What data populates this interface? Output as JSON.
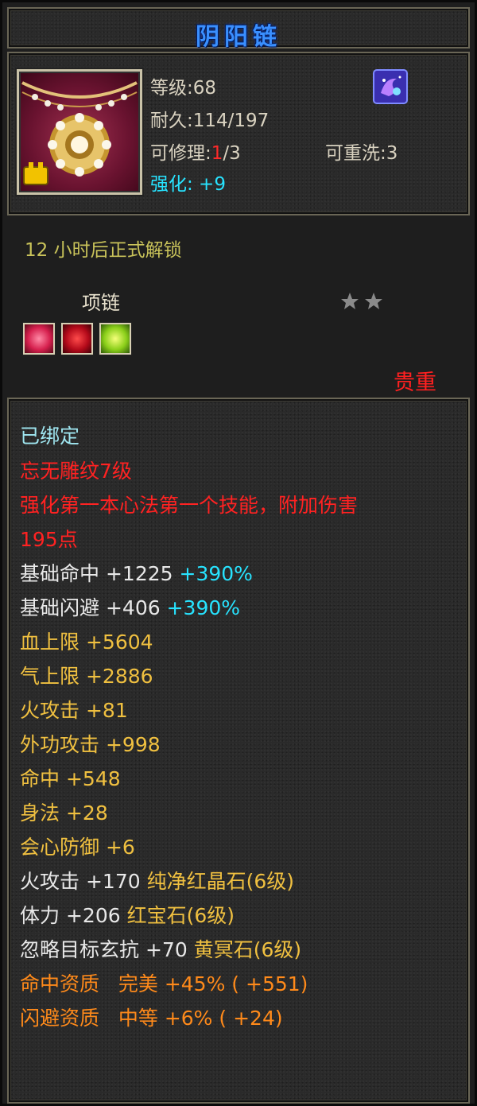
{
  "item": {
    "name": "阴阳链",
    "level_label": "等级",
    "level_value": ":68",
    "durability_label": "耐久",
    "durability_value": ":114/197",
    "repair_label": "可修理",
    "repair_sep": ":",
    "repair_used": "1",
    "repair_total": "/3",
    "rewash_label": "可重洗",
    "rewash_value": ":3",
    "enhance_label": "强化",
    "enhance_value": ":  +9",
    "unlock_text": "12 小时后正式解锁",
    "type": "项链",
    "stars": 2,
    "rarity": "贵重",
    "sockets": [
      "red-gem-icon",
      "crimson-gem-icon",
      "green-gem-icon"
    ]
  },
  "stats": {
    "bound": "已绑定",
    "engrave": "忘无雕纹7级",
    "skill_line1": "强化第一本心法第一个技能，附加伤害",
    "skill_line2": "195点",
    "hit_base": {
      "label": "基础命中",
      "value": "+1225",
      "bonus": "+390%"
    },
    "dodge_base": {
      "label": "基础闪避",
      "value": "+406",
      "bonus": "+390%"
    },
    "hp": {
      "label": "血上限",
      "value": "+5604"
    },
    "mp": {
      "label": "气上限",
      "value": "+2886"
    },
    "fire_atk": {
      "label": "火攻击",
      "value": "+81"
    },
    "ext_atk": {
      "label": "外功攻击",
      "value": "+998"
    },
    "hit": {
      "label": "命中",
      "value": "+548"
    },
    "agility": {
      "label": "身法",
      "value": "+28"
    },
    "crit_def": {
      "label": "会心防御",
      "value": "+6"
    },
    "gem1": {
      "label": "火攻击",
      "value": "+170",
      "gem": "纯净红晶石(6级)"
    },
    "gem2": {
      "label": "体力",
      "value": "+206",
      "gem": "红宝石(6级)"
    },
    "gem3": {
      "label": "忽略目标玄抗",
      "value": "+70",
      "gem": "黄冥石(6级)"
    },
    "apt1": {
      "label": "命中资质",
      "grade": "完美",
      "value": "+45%",
      "extra": "( +551)"
    },
    "apt2": {
      "label": "闪避资质",
      "grade": "中等",
      "value": "+6%",
      "extra": "( +24)"
    }
  },
  "colors": {
    "title": "#3a8fff",
    "stat_text": "#d9d2c0",
    "highlight_red": "#ff2222",
    "attribute_gold": "#f0c040",
    "aptitude_orange": "#ff8a1a",
    "cyan": "#27e3ff"
  }
}
